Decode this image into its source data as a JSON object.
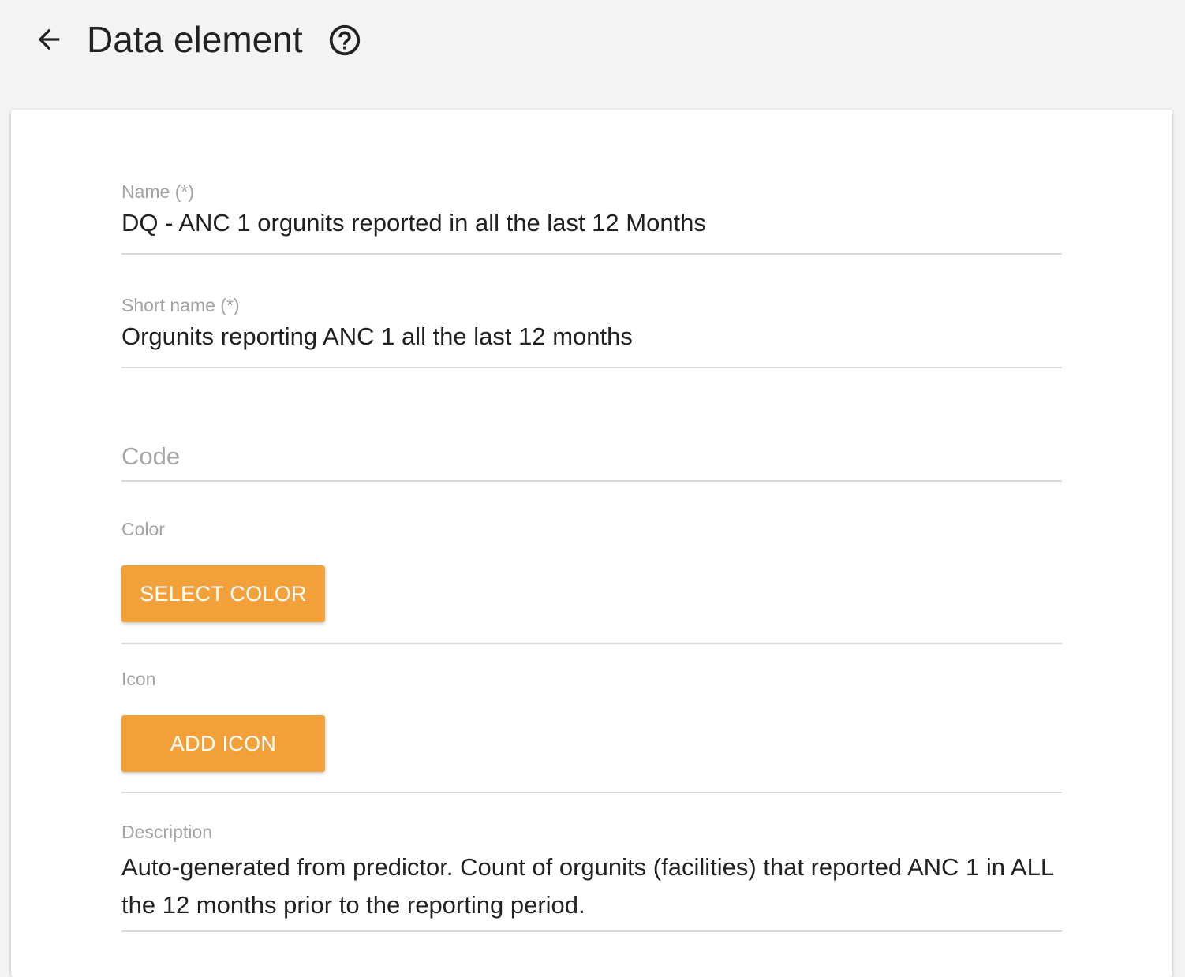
{
  "header": {
    "title": "Data element",
    "back_icon": "arrow-left-icon",
    "help_icon": "help-circle-icon"
  },
  "form": {
    "name": {
      "label": "Name (*)",
      "value": "DQ - ANC 1 orgunits reported in all the last 12 Months"
    },
    "short_name": {
      "label": "Short name (*)",
      "value": "Orgunits reporting ANC 1 all the last 12 months"
    },
    "code": {
      "placeholder": "Code",
      "value": ""
    },
    "color": {
      "label": "Color",
      "button_label": "SELECT COLOR"
    },
    "icon": {
      "label": "Icon",
      "button_label": "ADD ICON"
    },
    "description": {
      "label": "Description",
      "value": "Auto-generated from predictor. Count of orgunits (facilities) that reported ANC 1 in ALL the 12 months prior to the reporting period."
    }
  },
  "colors": {
    "accent": "#f2a03a",
    "background": "#f3f3f3",
    "card": "#ffffff"
  }
}
